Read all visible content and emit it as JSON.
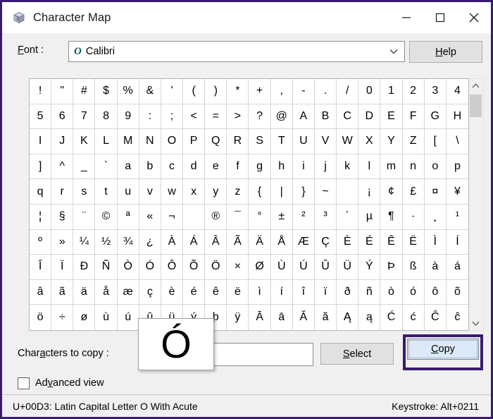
{
  "window": {
    "title": "Character Map",
    "border_color": "#3a1a70",
    "icon": "character-map-cube-icon"
  },
  "titlebar": {
    "minimize_icon": "minimize-icon",
    "maximize_icon": "maximize-icon",
    "close_icon": "close-icon"
  },
  "font_row": {
    "label": "Font :",
    "label_accesskey": "F",
    "selected_font": "Calibri",
    "font_type_icon": "opentype-O-icon",
    "dropdown_icon": "chevron-down-icon",
    "help_label": "Help",
    "help_accesskey": "H"
  },
  "grid": {
    "columns": 20,
    "rows": 10,
    "selected_char": "Ó",
    "characters": [
      "!",
      "\"",
      "#",
      "$",
      "%",
      "&",
      "'",
      "(",
      ")",
      "*",
      "+",
      ",",
      "-",
      ".",
      "/",
      "0",
      "1",
      "2",
      "3",
      "4",
      "5",
      "6",
      "7",
      "8",
      "9",
      ":",
      ";",
      "<",
      "=",
      ">",
      "?",
      "@",
      "A",
      "B",
      "C",
      "D",
      "E",
      "F",
      "G",
      "H",
      "I",
      "J",
      "K",
      "L",
      "M",
      "N",
      "O",
      "P",
      "Q",
      "R",
      "S",
      "T",
      "U",
      "V",
      "W",
      "X",
      "Y",
      "Z",
      "[",
      "\\",
      "]",
      "^",
      "_",
      "`",
      "a",
      "b",
      "c",
      "d",
      "e",
      "f",
      "g",
      "h",
      "i",
      "j",
      "k",
      "l",
      "m",
      "n",
      "o",
      "p",
      "q",
      "r",
      "s",
      "t",
      "u",
      "v",
      "w",
      "x",
      "y",
      "z",
      "{",
      "|",
      "}",
      "~",
      "",
      "¡",
      "¢",
      "£",
      "¤",
      "¥",
      "¦",
      "§",
      "¨",
      "©",
      "ª",
      "«",
      "¬",
      "­",
      "®",
      "¯",
      "°",
      "±",
      "²",
      "³",
      "´",
      "µ",
      "¶",
      "·",
      "¸",
      "¹",
      "º",
      "»",
      "¼",
      "½",
      "¾",
      "¿",
      "À",
      "Á",
      "Â",
      "Ã",
      "Ä",
      "Å",
      "Æ",
      "Ç",
      "È",
      "É",
      "Ê",
      "Ë",
      "Ì",
      "Í",
      "Î",
      "Ï",
      "Ð",
      "Ñ",
      "Ò",
      "Ó",
      "Ô",
      "Õ",
      "Ö",
      "×",
      "Ø",
      "Ù",
      "Ú",
      "Û",
      "Ü",
      "Ý",
      "Þ",
      "ß",
      "à",
      "á",
      "â",
      "ã",
      "ä",
      "å",
      "æ",
      "ç",
      "è",
      "é",
      "ê",
      "ë",
      "ì",
      "í",
      "î",
      "ï",
      "ð",
      "ñ",
      "ò",
      "ó",
      "ô",
      "õ",
      "ö",
      "÷",
      "ø",
      "ù",
      "ú",
      "û",
      "ü",
      "ý",
      "þ",
      "ÿ",
      "Ā",
      "ā",
      "Ă",
      "ă",
      "Ą",
      "ą",
      "Ć",
      "ć",
      "Ĉ",
      "ĉ"
    ]
  },
  "scrollbar": {
    "up_icon": "chevron-up-icon",
    "down_icon": "chevron-down-icon",
    "thumb": "scrollbar-thumb"
  },
  "magnifier": {
    "char": "Ó"
  },
  "copy_row": {
    "label": "Characters to copy :",
    "label_accesskey": "a",
    "input_value": "Ó",
    "input_placeholder": "",
    "select_label": "Select",
    "select_accesskey": "S",
    "copy_label": "Copy",
    "copy_accesskey": "C",
    "copy_highlight_color": "#3a1a70"
  },
  "advanced": {
    "label": "Advanced view",
    "label_accesskey": "v",
    "checked": false
  },
  "statusbar": {
    "left": "U+00D3: Latin Capital Letter O With Acute",
    "right": "Keystroke: Alt+0211"
  }
}
